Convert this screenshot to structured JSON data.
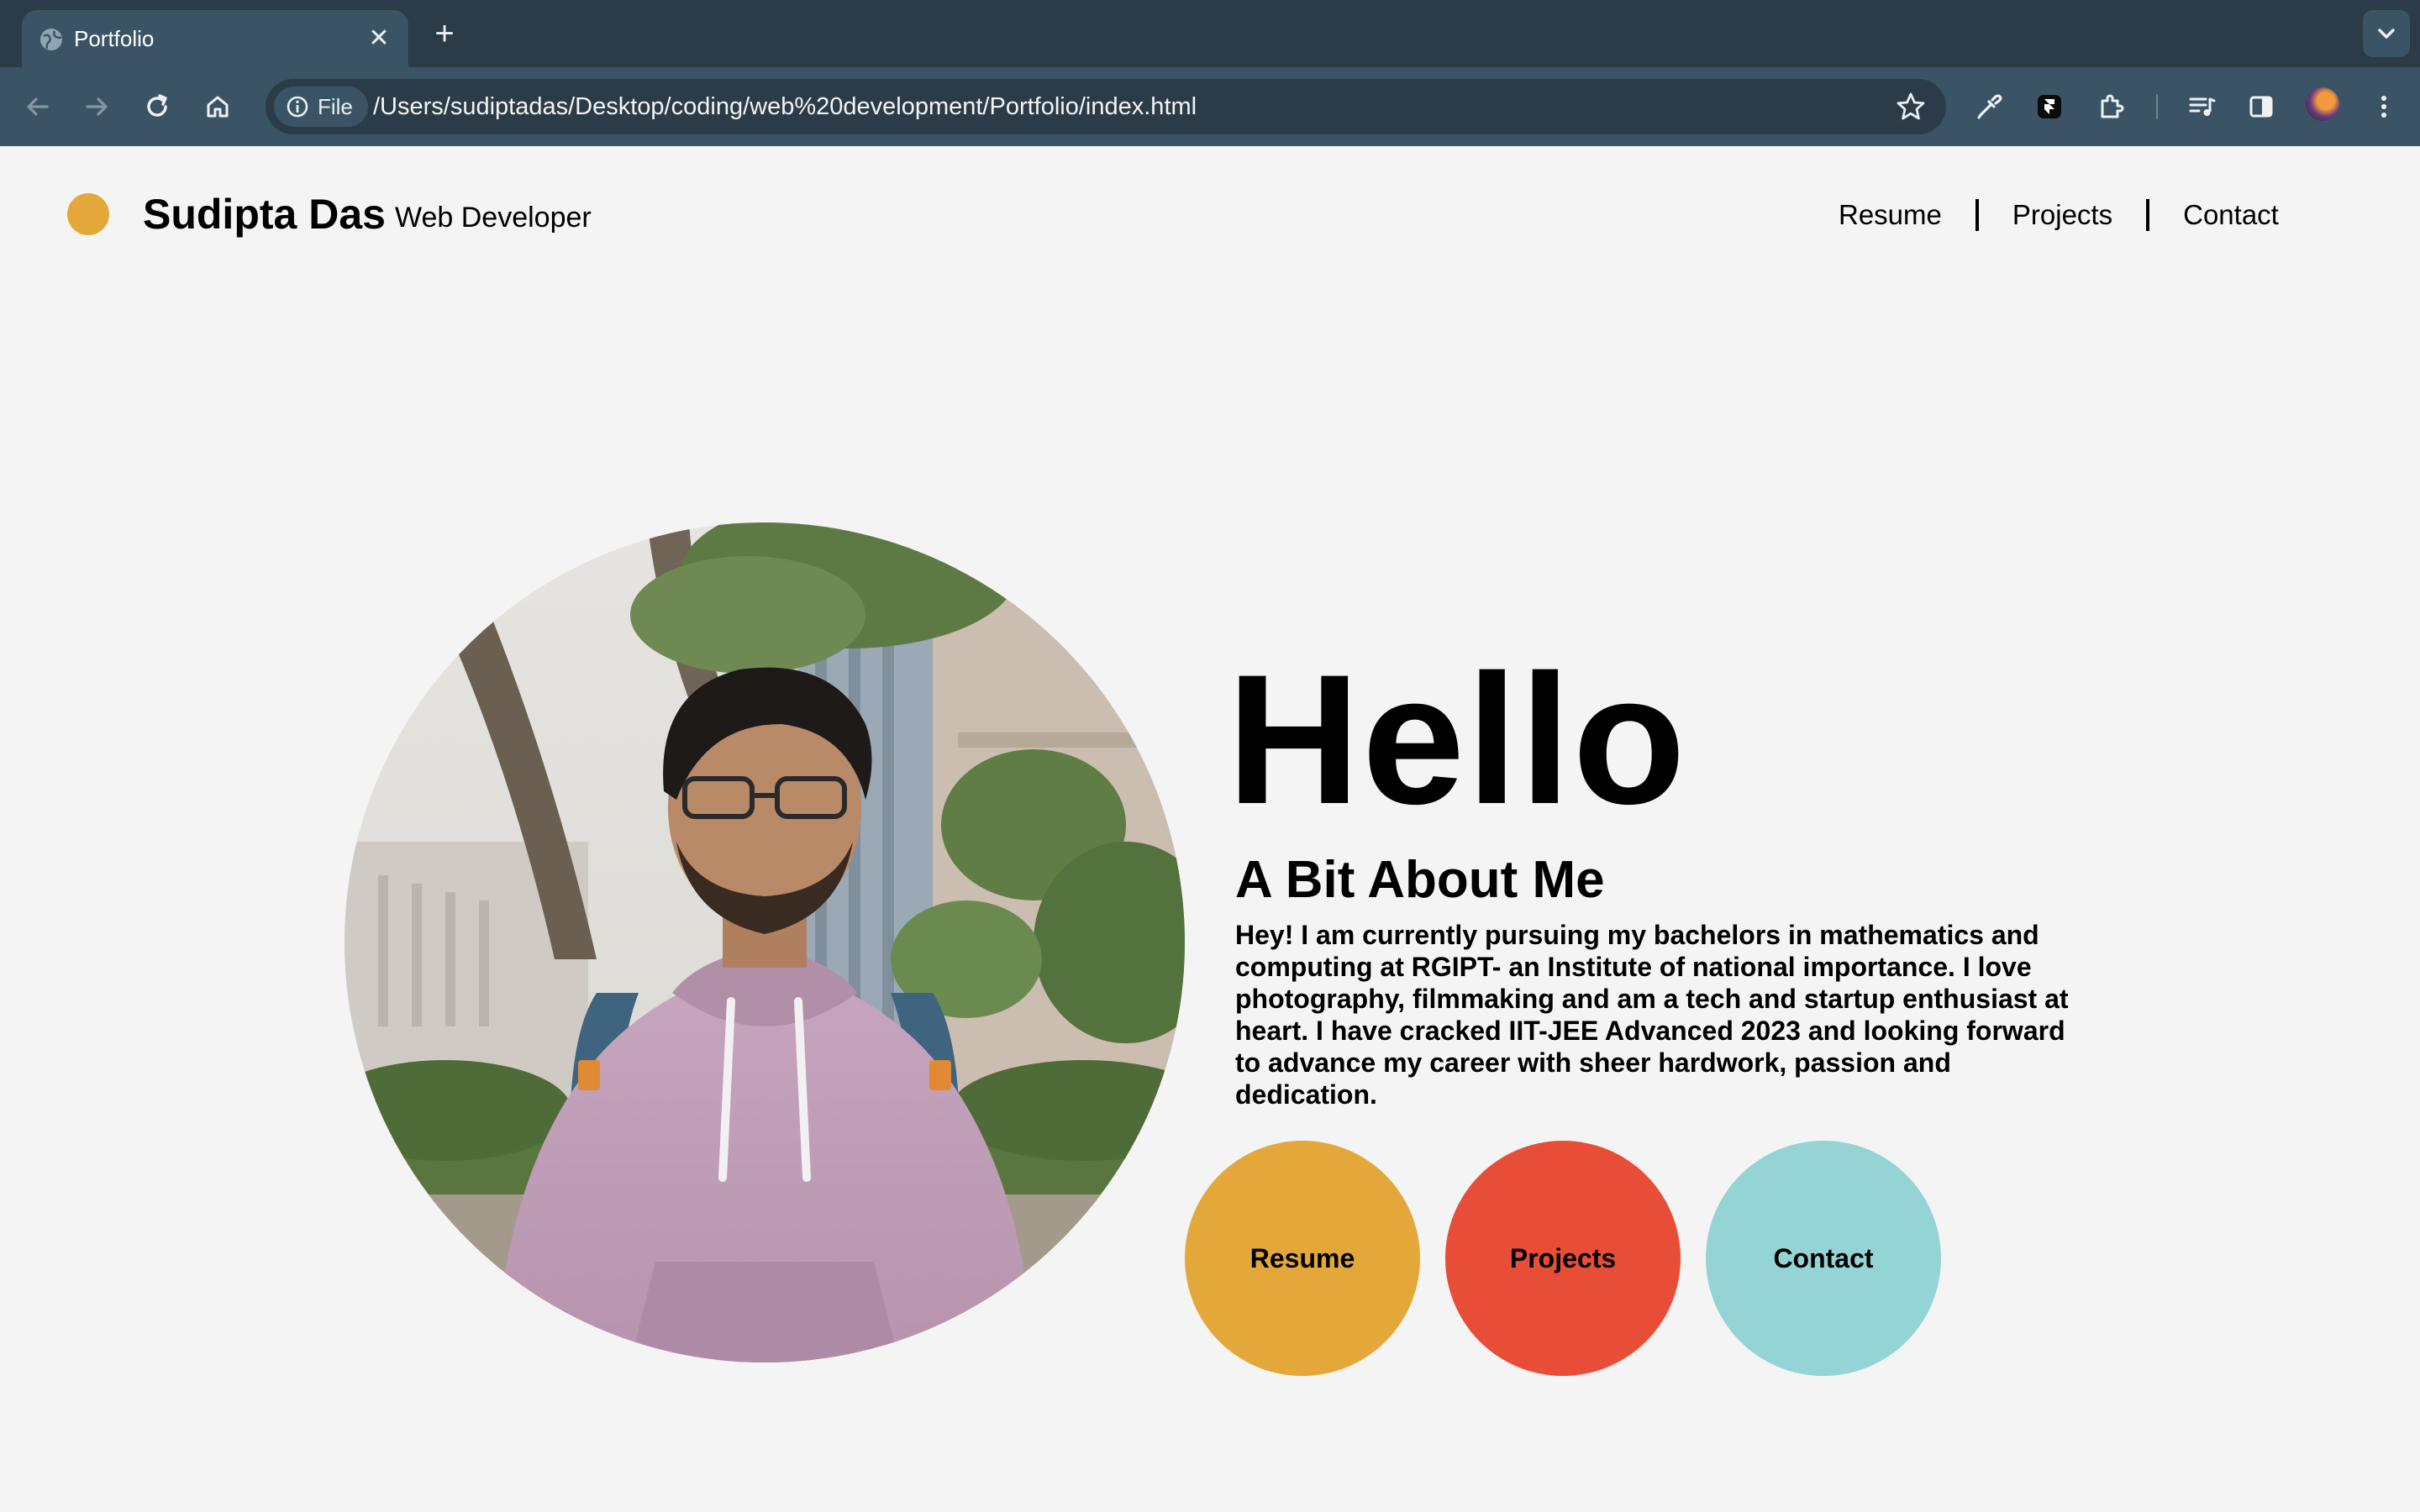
{
  "browser": {
    "tab_title": "Portfolio",
    "chip_label": "File",
    "url": "/Users/sudiptadas/Desktop/coding/web%20development/Portfolio/index.html",
    "icons": {
      "back": "arrow-left-icon",
      "forward": "arrow-right-icon",
      "reload": "reload-icon",
      "home": "home-icon",
      "info": "info-icon",
      "bookmark": "star-icon",
      "eyedropper": "eyedropper-icon",
      "extension_app": "framer-icon",
      "extensions": "puzzle-icon",
      "media": "media-controls-icon",
      "side_panel": "side-panel-icon",
      "menu": "kebab-menu-icon"
    }
  },
  "header": {
    "name": "Sudipta Das",
    "role": "Web Developer",
    "nav": [
      "Resume",
      "Projects",
      "Contact"
    ]
  },
  "hero": {
    "greeting": "Hello",
    "about_title": "A Bit About Me",
    "about_text": "Hey! I am currently pursuing my bachelors in mathematics and computing at RGIPT- an Institute of national importance. I love photography, filmmaking and am a tech and startup enthusiast at heart. I have cracked IIT-JEE Advanced 2023 and looking forward to advance my career with sheer hardwork, passion and dedication.",
    "buttons": [
      {
        "label": "Resume",
        "color": "#e4a73a"
      },
      {
        "label": "Projects",
        "color": "#e84e37"
      },
      {
        "label": "Contact",
        "color": "#94d4d5"
      }
    ]
  },
  "colors": {
    "accent": "#e4a73a",
    "page_bg": "#f4f4f4",
    "chrome_dark": "#2b3b48",
    "chrome_toolbar": "#3b5465"
  }
}
